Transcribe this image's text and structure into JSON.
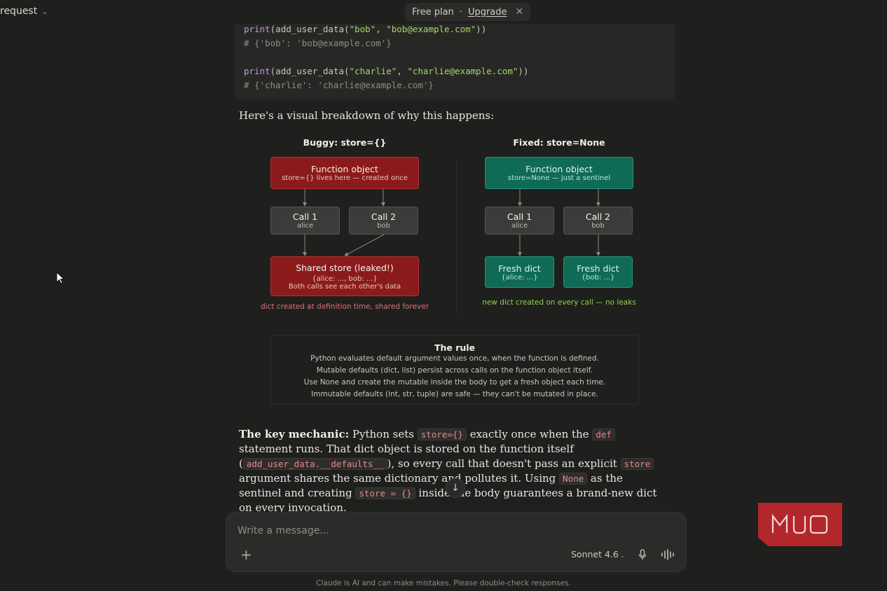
{
  "topbar": {
    "title": "request"
  },
  "banner": {
    "plan": "Free plan",
    "sep": "·",
    "upgrade": "Upgrade"
  },
  "code": {
    "lines": [
      "print(add_user_data(\"bob\", \"bob@example.com\"))",
      "# {'bob': 'bob@example.com'}",
      "",
      "print(add_user_data(\"charlie\", \"charlie@example.com\"))",
      "# {'charlie': 'charlie@example.com'}"
    ]
  },
  "intro": "Here's a visual breakdown of why this happens:",
  "diagram": {
    "buggy": {
      "title": "Buggy: store={}",
      "function_title": "Function object",
      "function_sub": "store={} lives here — created once",
      "call1_title": "Call 1",
      "call1_sub": "alice",
      "call2_title": "Call 2",
      "call2_sub": "bob",
      "store_title": "Shared store (leaked!)",
      "store_sub1": "{alice: ..., bob: ...}",
      "store_sub2": "Both calls see each other's data",
      "note": "dict created at definition time, shared forever"
    },
    "fixed": {
      "title": "Fixed: store=None",
      "function_title": "Function object",
      "function_sub": "store=None — just a sentinel",
      "call1_title": "Call 1",
      "call1_sub": "alice",
      "call2_title": "Call 2",
      "call2_sub": "bob",
      "dict1_title": "Fresh dict",
      "dict1_sub": "{alice: ...}",
      "dict2_title": "Fresh dict",
      "dict2_sub": "{bob: ...}",
      "note": "new dict created on every call — no leaks"
    },
    "rule": {
      "title": "The rule",
      "lines": [
        "Python evaluates default argument values once, when the function is defined.",
        "Mutable defaults (dict, list) persist across calls on the function object itself.",
        "Use None and create the mutable inside the body to get a fresh object each time.",
        "Immutable defaults (int, str, tuple) are safe — they can't be mutated in place."
      ]
    }
  },
  "mechanic": {
    "bold": "The key mechanic:",
    "t1": " Python sets ",
    "c1": "store={}",
    "t2": " exactly once when the ",
    "c2": "def",
    "t3": " statement runs. That dict object is stored on the function itself (",
    "c3": "add_user_data.__defaults__",
    "t4": "), so every call that doesn't pass an explicit ",
    "c4": "store",
    "t5": " argument shares the same dictionary and pollutes it. Using ",
    "c5": "None",
    "t6": " as the sentinel and creating ",
    "c6": "store = {}",
    "t7": " inside the body guarantees a brand-new dict on every invocation."
  },
  "composer": {
    "placeholder": "Write a message...",
    "model": "Sonnet 4.6"
  },
  "disclaimer": "Claude is AI and can make mistakes. Please double-check responses.",
  "watermark": "MUO",
  "colors": {
    "buggy": "#8b1b1b",
    "fixed": "#0f6b55",
    "accent_code": "#e58a8a"
  },
  "icons": [
    "chevron-down-icon",
    "close-icon",
    "arrow-down-icon",
    "plus-icon",
    "microphone-icon",
    "voice-wave-icon",
    "mouse-cursor-icon"
  ]
}
